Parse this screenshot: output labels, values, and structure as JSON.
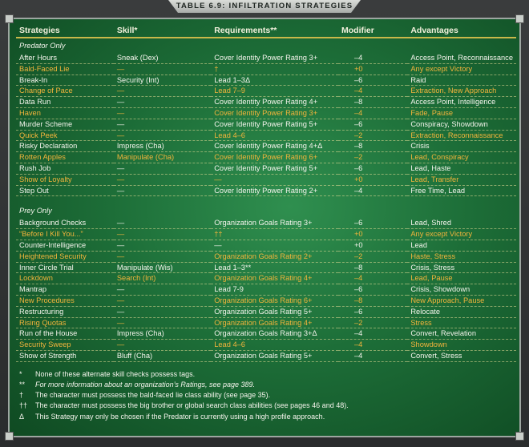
{
  "title": "TABLE 6.9: INFILTRATION STRATEGIES",
  "columns": [
    "Strategies",
    "Skill*",
    "Requirements**",
    "Modifier",
    "Advantages"
  ],
  "sections": [
    {
      "heading": "Predator Only",
      "rows": [
        [
          "After Hours",
          "Sneak (Dex)",
          "Cover Identity Power Rating 3+",
          "–4",
          "Access Point, Reconnaissance"
        ],
        [
          "Bald-Faced Lie",
          "—",
          "†",
          "+0",
          "Any except Victory"
        ],
        [
          "Break-In",
          "Security (Int)",
          "Lead 1–3Δ",
          "–6",
          "Raid"
        ],
        [
          "Change of Pace",
          "—",
          "Lead 7–9",
          "–4",
          "Extraction, New Approach"
        ],
        [
          "Data Run",
          "—",
          "Cover Identity Power Rating 4+",
          "–8",
          "Access Point, Intelligence"
        ],
        [
          "Haven",
          "—",
          "Cover Identity Power Rating 3+",
          "–4",
          "Fade, Pause"
        ],
        [
          "Murder Scheme",
          "—",
          "Cover Identity Power Rating 5+",
          "–6",
          "Conspiracy, Showdown"
        ],
        [
          "Quick Peek",
          "—",
          "Lead 4–6",
          "–2",
          "Extraction, Reconnaissance"
        ],
        [
          "Risky Declaration",
          "Impress (Cha)",
          "Cover Identity Power Rating 4+Δ",
          "–8",
          "Crisis"
        ],
        [
          "Rotten Apples",
          "Manipulate (Cha)",
          "Cover Identity Power Rating 6+",
          "–2",
          "Lead, Conspiracy"
        ],
        [
          "Rush Job",
          "—",
          "Cover Identity Power Rating 5+",
          "–6",
          "Lead, Haste"
        ],
        [
          "Show of Loyalty",
          "—",
          "—",
          "+0",
          "Lead, Transfer"
        ],
        [
          "Step Out",
          "—",
          "Cover Identity Power Rating 2+",
          "–4",
          "Free Time, Lead"
        ]
      ]
    },
    {
      "heading": "Prey Only",
      "rows": [
        [
          "Background Checks",
          "—",
          "Organization Goals Rating 3+",
          "–6",
          "Lead, Shred"
        ],
        [
          "“Before I Kill You...”",
          "—",
          "††",
          "+0",
          "Any except Victory"
        ],
        [
          "Counter-Intelligence",
          "—",
          "—",
          "+0",
          "Lead"
        ],
        [
          "Heightened Security",
          "—",
          "Organization Goals Rating 2+",
          "–2",
          "Haste, Stress"
        ],
        [
          "Inner Circle Trial",
          "Manipulate (Wis)",
          "Lead 1–3**",
          "–8",
          "Crisis, Stress"
        ],
        [
          "Lockdown",
          "Search (Int)",
          "Organization Goals Rating 4+",
          "–4",
          "Lead, Pause"
        ],
        [
          "Mantrap",
          "—",
          "Lead 7-9",
          "–6",
          "Crisis, Showdown"
        ],
        [
          "New Procedures",
          "—",
          "Organization Goals Rating 6+",
          "–8",
          "New Approach, Pause"
        ],
        [
          "Restructuring",
          "—",
          "Organization Goals Rating 5+",
          "–6",
          "Relocate"
        ],
        [
          "Rising Quotas",
          "—",
          "Organization Goals Rating 4+",
          "–2",
          "Stress"
        ],
        [
          "Run of the House",
          "Impress (Cha)",
          "Organization Goals Rating 3+Δ",
          "–4",
          "Convert, Revelation"
        ],
        [
          "Security Sweep",
          "—",
          "Lead 4–6",
          "–4",
          "Showdown"
        ],
        [
          "Show of Strength",
          "Bluff (Cha)",
          "Organization Goals Rating 5+",
          "–4",
          "Convert, Stress"
        ]
      ]
    }
  ],
  "footnotes": [
    {
      "mark": "*",
      "text": "None of these alternate skill checks possess tags."
    },
    {
      "mark": "**",
      "text": "For more information about an organization’s Ratings, see page 389."
    },
    {
      "mark": "†",
      "text": "The character must possess the bald-faced lie class ability (see page 35)."
    },
    {
      "mark": "††",
      "text": "The character must possess the big brother or global search class abilities (see pages 46 and 48)."
    },
    {
      "mark": "Δ",
      "text": "This Strategy may only be chosen if the Predator is currently using a high profile approach."
    }
  ]
}
